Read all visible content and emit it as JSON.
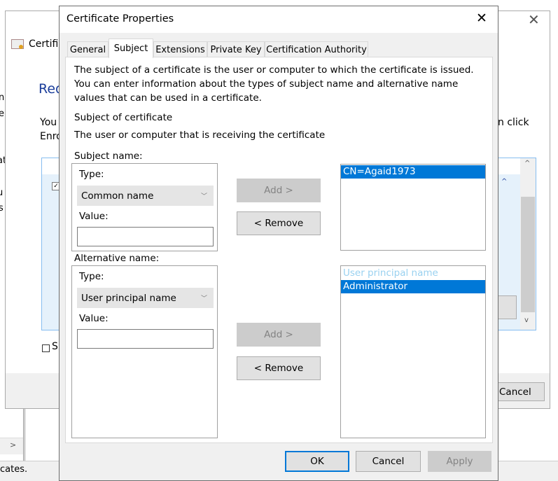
{
  "background_window": {
    "title": "Certific",
    "heading": "Req",
    "text_line1": "You",
    "text_line2": "Enro",
    "text_right": "n click",
    "show_label": "Sh",
    "cancel_label": "Cancel",
    "left_fragments": [
      "n",
      "e",
      "at",
      "u",
      "s"
    ],
    "status_text": "cates."
  },
  "dialog": {
    "title": "Certificate Properties",
    "tabs": [
      {
        "label": "General",
        "active": false
      },
      {
        "label": "Subject",
        "active": true
      },
      {
        "label": "Extensions",
        "active": false
      },
      {
        "label": "Private Key",
        "active": false
      },
      {
        "label": "Certification Authority",
        "active": false
      }
    ],
    "description": "The subject of a certificate is the user or computer to which the certificate is issued. You can enter information about the types of subject name and alternative name values that can be used in a certificate.",
    "section_title": "Subject of certificate",
    "section_desc": "The user or computer that is receiving the certificate",
    "subject_name": {
      "label": "Subject name:",
      "type_label": "Type:",
      "type_value": "Common name",
      "value_label": "Value:",
      "value": "",
      "add_label": "Add >",
      "remove_label": "< Remove",
      "list": [
        {
          "text": "CN=Agaid1973",
          "selected": true
        }
      ]
    },
    "alternative_name": {
      "label": "Alternative name:",
      "type_label": "Type:",
      "type_value": "User principal name",
      "value_label": "Value:",
      "value": "",
      "add_label": "Add >",
      "remove_label": "< Remove",
      "list_header": "User principal name",
      "list": [
        {
          "text": "Administrator",
          "selected": true
        }
      ]
    },
    "buttons": {
      "ok": "OK",
      "cancel": "Cancel",
      "apply": "Apply"
    }
  }
}
